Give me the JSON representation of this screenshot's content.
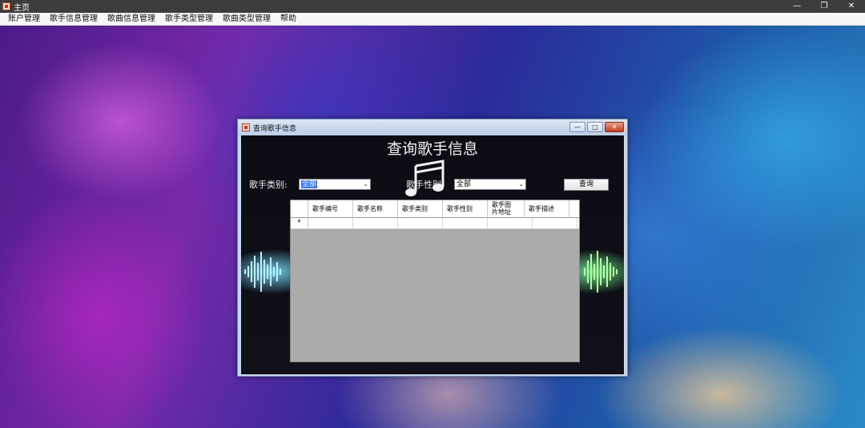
{
  "app": {
    "title": "主页",
    "window_controls": {
      "minimize": "—",
      "restore": "❐",
      "close": "✕"
    }
  },
  "menu": {
    "items": [
      {
        "label": "账户管理"
      },
      {
        "label": "歌手信息管理"
      },
      {
        "label": "歌曲信息管理"
      },
      {
        "label": "歌手类型管理"
      },
      {
        "label": "歌曲类型管理"
      },
      {
        "label": "帮助"
      }
    ]
  },
  "dialog": {
    "title": "查询歌手信息",
    "heading": "查询歌手信息",
    "controls": {
      "minimize": "—",
      "maximize": "□",
      "close": "✕"
    },
    "filters": {
      "type_label": "歌手类别:",
      "type_value": "全部",
      "gender_label": "歌手性别:",
      "gender_value": "全部"
    },
    "query_button": "查询",
    "grid": {
      "columns": [
        {
          "label": "歌手编号"
        },
        {
          "label": "歌手名称"
        },
        {
          "label": "歌手类别"
        },
        {
          "label": "歌手性别"
        },
        {
          "label": "歌手图片地址"
        },
        {
          "label": "歌手描述"
        }
      ],
      "new_row_marker": "*"
    }
  },
  "colors": {
    "titlebar": "#3c3c3c",
    "menubar": "#f7f7f7",
    "dialog_frame": "#c9d7ea",
    "close_button": "#c43e24",
    "grid_background": "#ababab",
    "combo_selection": "#3377ff"
  }
}
